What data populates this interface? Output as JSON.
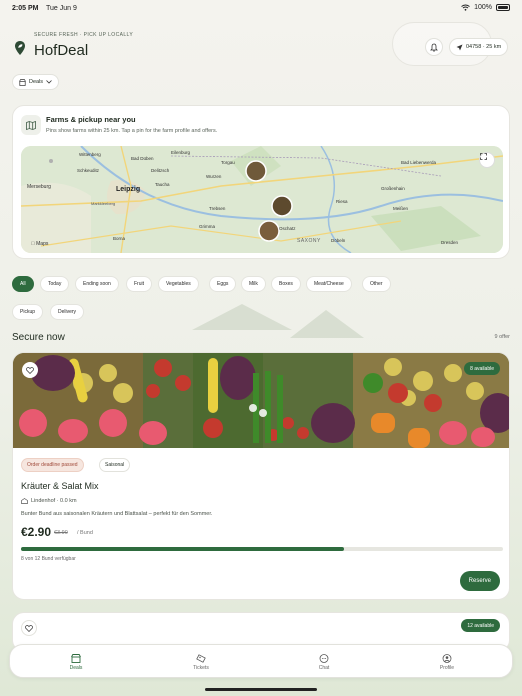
{
  "status_bar": {
    "time": "2:05 PM",
    "date": "Tue Jun 9",
    "battery": "100%"
  },
  "header": {
    "tagline": "SECURE FRESH · PICK UP LOCALLY",
    "brand": "HofDeal",
    "location": "04758 · 25 km",
    "icons": {
      "logo": "leaf-pin-icon",
      "bell": "bell-icon",
      "location": "navigation-arrow-icon"
    }
  },
  "mode_dropdown": {
    "label": "Deals"
  },
  "map_card": {
    "title": "Farms & pickup near you",
    "subtitle": "Pins show farms within 25 km. Tap a pin for the farm profile and offers.",
    "attribution": "Maps",
    "place_labels": [
      "Wittenberg",
      "Eilenburg",
      "Torgau",
      "Merseburg",
      "Leipzig",
      "Wurzen",
      "Oschatz",
      "Riesa",
      "Grimma",
      "Borna",
      "Döbeln",
      "Meißen",
      "SAXONY",
      "Dresden",
      "Markkleeberg",
      "Delitzsch",
      "Schkeuditz",
      "Bad Düben",
      "Taucha",
      "Trebsen",
      "Großenhain",
      "Bad Liebenwerda"
    ]
  },
  "filters": {
    "chips": [
      "All",
      "Today",
      "Ending soon",
      "Fruit",
      "Vegetables",
      "Eggs",
      "Milk",
      "Boxes",
      "Meat/Cheese",
      "Other",
      "Pickup",
      "Delivery"
    ],
    "active": "All"
  },
  "section": {
    "title": "Secure now",
    "count": "9 offer"
  },
  "deal": {
    "available": "8 available",
    "badge_deadline": "Order deadline passed",
    "badge_season": "Saisonal",
    "title": "Kräuter & Salat Mix",
    "farm": "Lindenhof · 0.0 km",
    "description": "Bunter Bund aus saisonalen Kräutern und Blattsalat – perfekt für den Sommer.",
    "price": "€2.90",
    "old_price": "€3.90",
    "unit": "/ Bund",
    "progress_fraction": 0.67,
    "progress_text": "8 von 12 Bund verfügbar",
    "reserve_label": "Reserve"
  },
  "deal2": {
    "available": "12 available"
  },
  "tabbar": {
    "tabs": [
      {
        "label": "Deals",
        "icon": "store-icon"
      },
      {
        "label": "Tickets",
        "icon": "ticket-icon"
      },
      {
        "label": "Chat",
        "icon": "chat-bubble-icon"
      },
      {
        "label": "Profile",
        "icon": "person-icon"
      }
    ],
    "active": "Deals"
  },
  "colors": {
    "accent": "#2e6b3e",
    "deadline_badge": "#f6e6df",
    "background": "#f4f3ee"
  }
}
